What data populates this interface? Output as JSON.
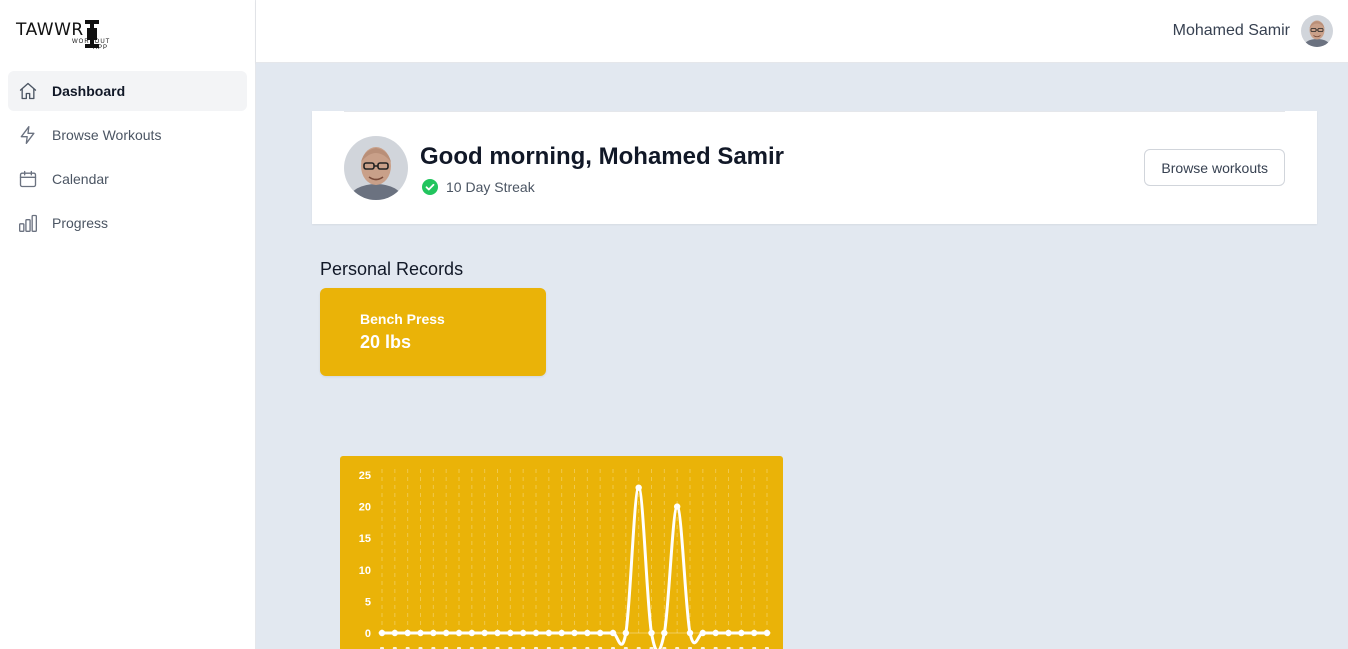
{
  "app": {
    "logo_text": "TAWWR",
    "logo_sub": "WORKOUT APP"
  },
  "sidebar": {
    "items": [
      {
        "label": "Dashboard",
        "icon": "home-icon",
        "active": true
      },
      {
        "label": "Browse Workouts",
        "icon": "lightning-icon",
        "active": false
      },
      {
        "label": "Calendar",
        "icon": "calendar-icon",
        "active": false
      },
      {
        "label": "Progress",
        "icon": "bar-chart-icon",
        "active": false
      }
    ]
  },
  "header": {
    "user_name": "Mohamed Samir"
  },
  "greeting_card": {
    "greeting": "Good morning, Mohamed Samir",
    "streak": "10 Day Streak",
    "browse_button": "Browse workouts"
  },
  "personal_records": {
    "title": "Personal Records",
    "records": [
      {
        "name": "Bench Press",
        "value": "20 lbs"
      }
    ]
  },
  "colors": {
    "accent": "#eab308",
    "background": "#e2e8f0",
    "success": "#22c55e"
  },
  "chart_data": {
    "type": "line",
    "title": "",
    "xlabel": "",
    "ylabel": "",
    "ylim": [
      0,
      25
    ],
    "yticks": [
      "0",
      "5",
      "10",
      "15",
      "20",
      "25"
    ],
    "grid": true,
    "series": [
      {
        "values": [
          0,
          0,
          0,
          0,
          0,
          0,
          0,
          0,
          0,
          0,
          0,
          0,
          0,
          0,
          0,
          0,
          0,
          0,
          0,
          0,
          23,
          0,
          0,
          20,
          0,
          0,
          0,
          0,
          0,
          0,
          0
        ]
      }
    ]
  }
}
